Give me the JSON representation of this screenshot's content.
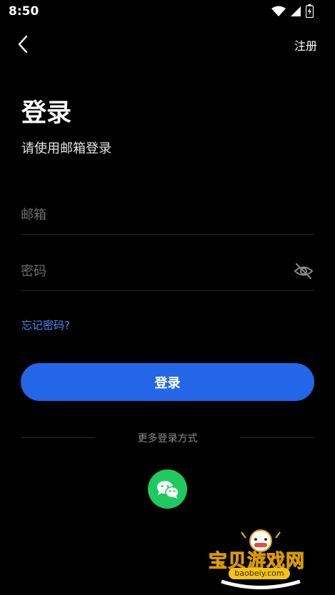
{
  "status_bar": {
    "time": "8:50"
  },
  "header": {
    "register_label": "注册"
  },
  "main": {
    "title": "登录",
    "subtitle": "请使用邮箱登录",
    "email_placeholder": "邮箱",
    "password_placeholder": "密码",
    "forgot_password": "忘记密码?",
    "login_button": "登录",
    "more_login_label": "更多登录方式"
  },
  "watermark": {
    "site_name": "宝贝游戏网",
    "url": "baobeiy.com"
  },
  "colors": {
    "background": "#000000",
    "primary": "#2466e8",
    "link": "#4a8df8",
    "wechat": "#1ec95f"
  },
  "icons": [
    "wifi-icon",
    "signal-icon",
    "battery-icon",
    "back-icon",
    "eye-off-icon",
    "wechat-icon"
  ]
}
